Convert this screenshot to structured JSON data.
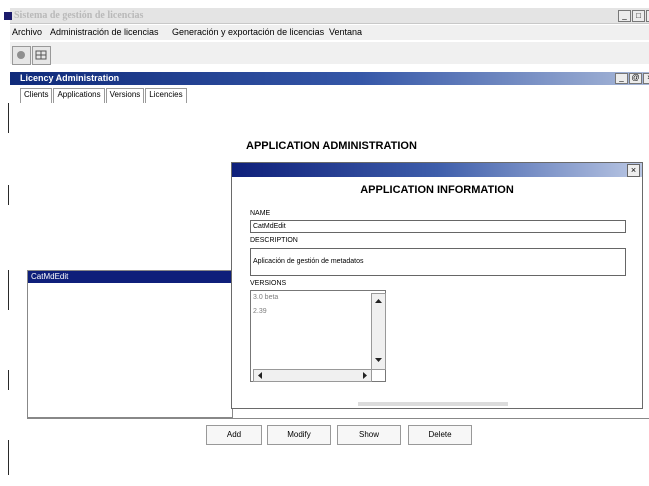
{
  "window": {
    "title": "Sistema de gestión de licencias",
    "min": "_",
    "max": "□",
    "close": "×"
  },
  "menu": [
    "Archivo",
    "Administración de licencias",
    "Generación y exportación de licencias",
    "Ventana"
  ],
  "inner_window": {
    "title": "Licency Administration",
    "min": "_",
    "restore": "@",
    "close": "×"
  },
  "tabs": [
    "Clients",
    "Applications",
    "Versions",
    "Licencies"
  ],
  "heading": "APPLICATION ADMINISTRATION",
  "list": {
    "selected": "CatMdEdit"
  },
  "dialog": {
    "title": "APPLICATION INFORMATION",
    "close": "×",
    "name_label": "NAME",
    "name_value": "CatMdEdit",
    "description_label": "DESCRIPTION",
    "description_value": "Aplicación de gestión de metadatos",
    "versions_label": "VERSIONS",
    "versions": [
      "3.0 beta",
      "2.39"
    ]
  },
  "buttons": {
    "add": "Add",
    "modify": "Modify",
    "show": "Show",
    "delete": "Delete"
  }
}
